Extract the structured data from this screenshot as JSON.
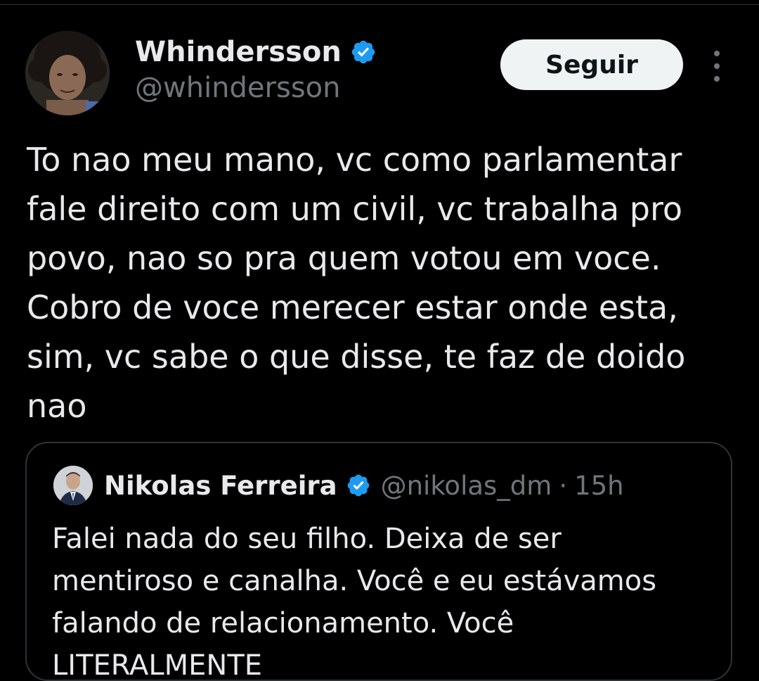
{
  "tweet": {
    "author": {
      "name": "Whindersson",
      "handle": "@whindersson",
      "verified": true
    },
    "follow_label": "Seguir",
    "text_lines": [
      "To nao meu mano, vc como parlamentar",
      "fale direito com um civil, vc trabalha pro",
      "povo, nao so pra quem votou em voce.",
      "Cobro de voce merecer estar onde esta,",
      "sim, vc sabe o que disse, te faz de doido",
      "nao"
    ]
  },
  "quote": {
    "author": {
      "name": "Nikolas Ferreira",
      "handle": "@nikolas_dm",
      "verified": true
    },
    "separator": "·",
    "time": "15h",
    "text_lines": [
      "Falei nada do seu filho. Deixa de ser",
      "mentiroso e canalha. Você e eu estávamos",
      "falando de relacionamento. Você",
      "LITERALMENTE"
    ]
  },
  "colors": {
    "background": "#000000",
    "text": "#e7e9ea",
    "secondary_text": "#71767b",
    "verified_badge": "#1d9bf0",
    "border": "#2f3336",
    "follow_button_bg": "#eff3f4"
  },
  "icons": {
    "verified": "verified-badge-icon",
    "more": "more-options-icon"
  }
}
